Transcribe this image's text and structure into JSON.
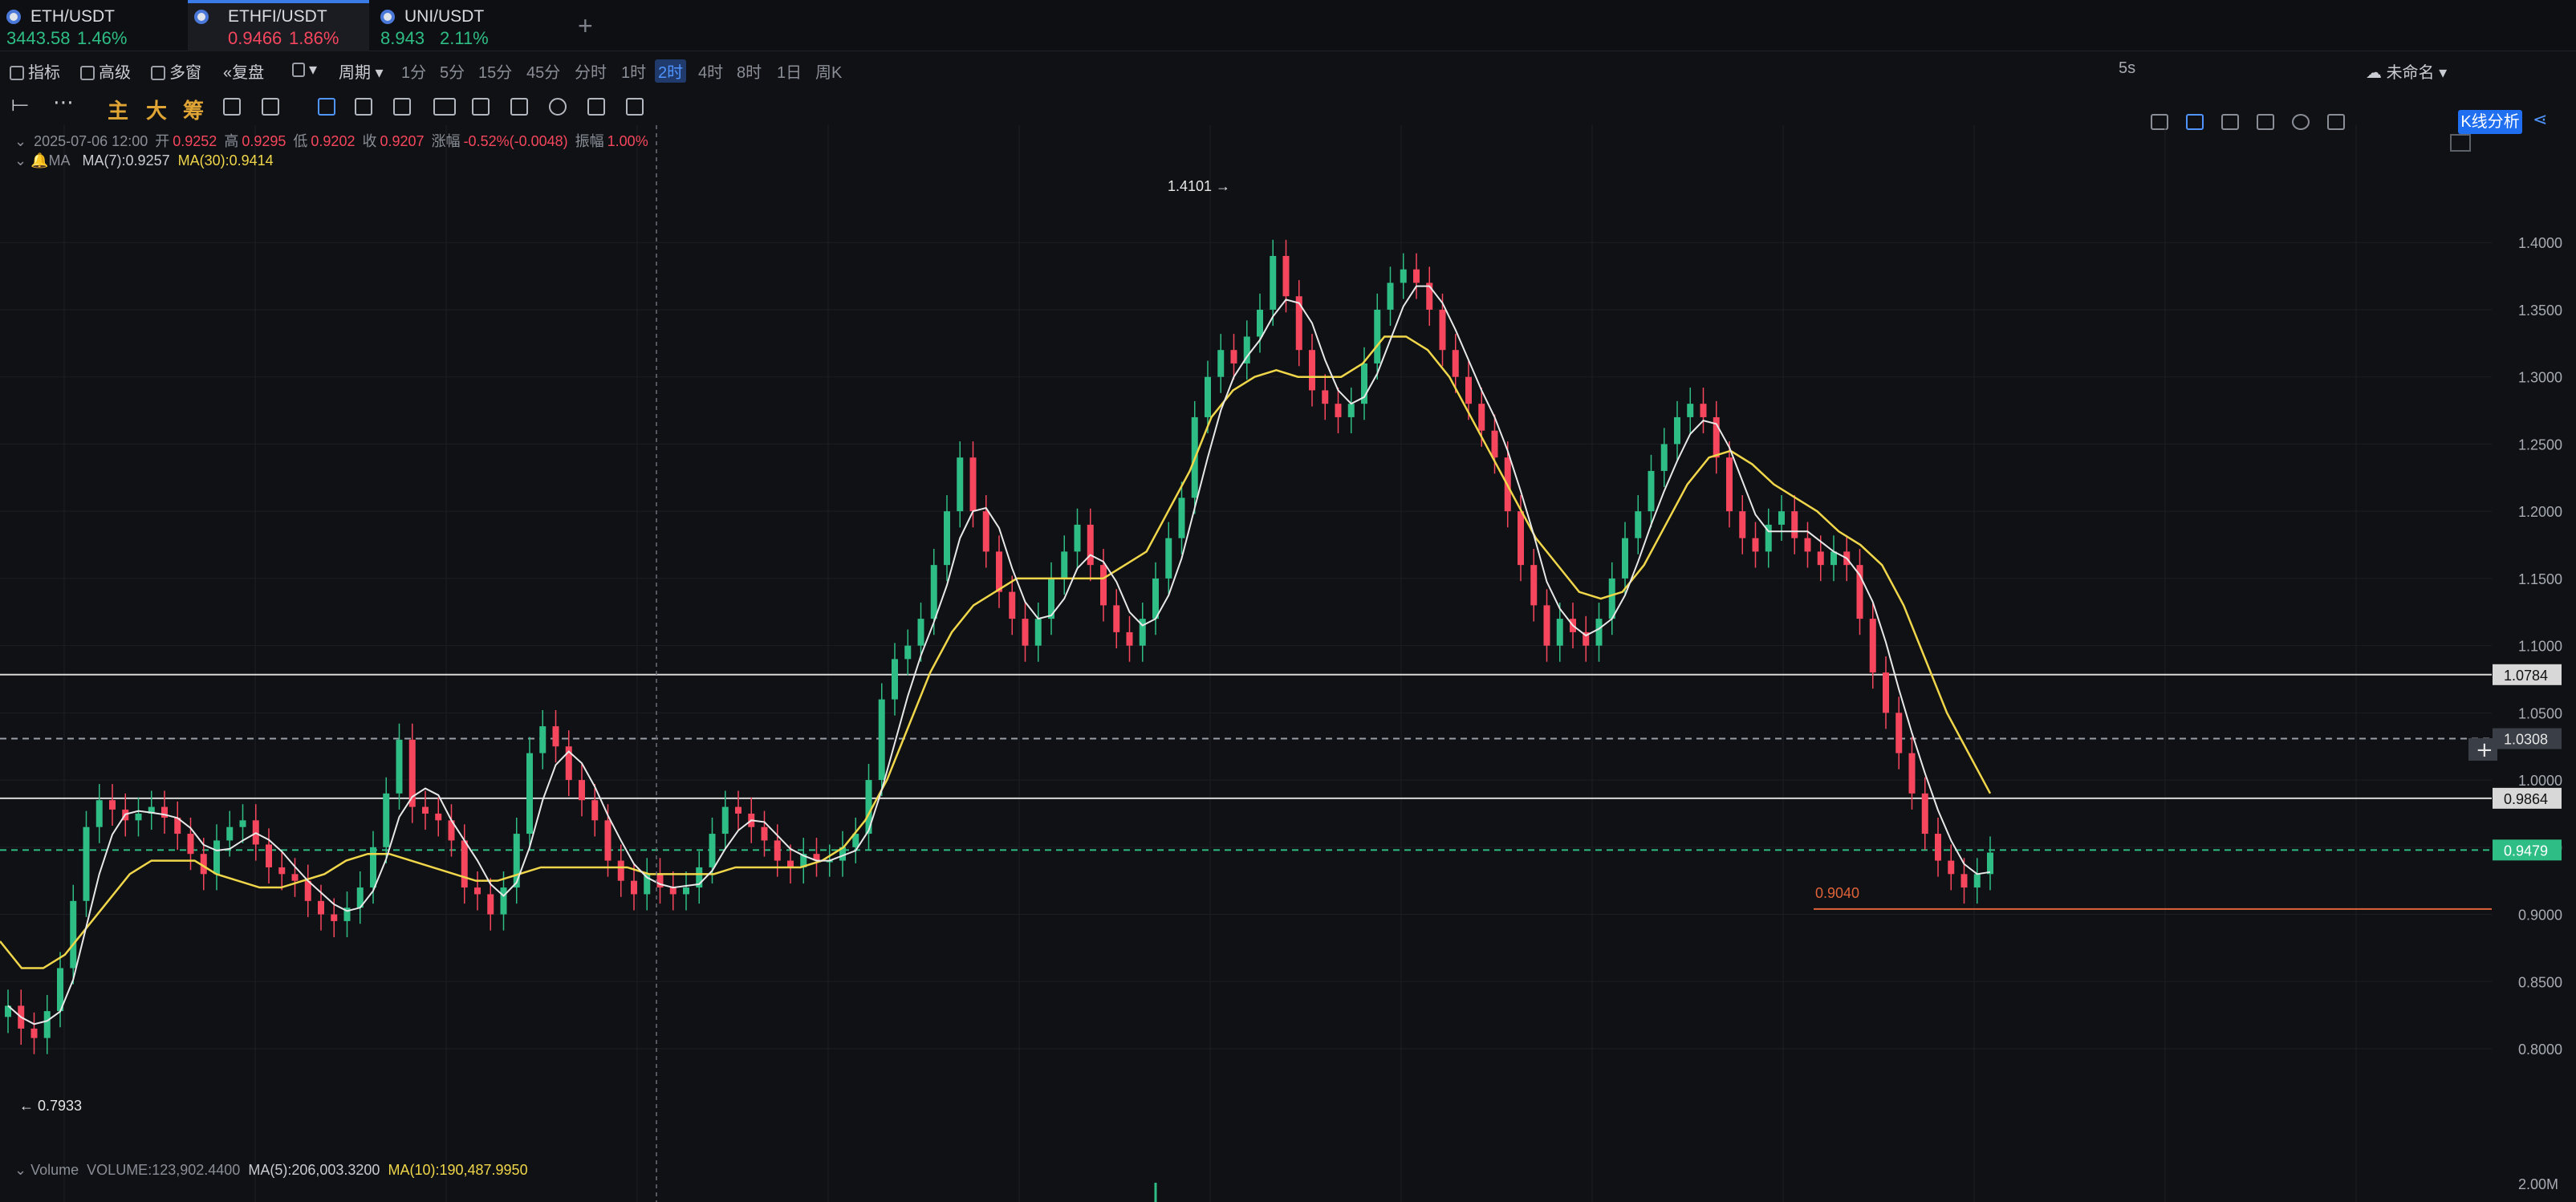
{
  "tabs": [
    {
      "pair": "ETH/USDT",
      "price": "3443.58",
      "change": "1.46%",
      "dir": "up"
    },
    {
      "pair": "ETHFI/USDT",
      "price": "0.9466",
      "change": "1.86%",
      "dir": "dn"
    },
    {
      "pair": "UNI/USDT",
      "price": "8.943",
      "change": "2.11%",
      "dir": "up"
    }
  ],
  "add_tab": "+",
  "toolbar": {
    "indicators": "指标",
    "advanced": "高级",
    "multi_window": "多窗",
    "replay": "复盘",
    "chart_type_icon": "candle-icon",
    "period": "周期",
    "periods": [
      "1分",
      "5分",
      "15分",
      "45分",
      "分时",
      "1时",
      "2时",
      "4时",
      "8时",
      "1日",
      "周K"
    ],
    "selected_period": "2时",
    "refresh": "5s",
    "layout_name": "未命名",
    "kline_analysis": "K线分析"
  },
  "drawing_tools": {
    "main": "主",
    "large": "大",
    "chips": "筹"
  },
  "ohlc": {
    "date": "2025-07-06 12:00",
    "open_label": "开",
    "open": "0.9252",
    "high_label": "高",
    "high": "0.9295",
    "low_label": "低",
    "low": "0.9202",
    "close_label": "收",
    "close": "0.9207",
    "change_label": "涨幅",
    "change": "-0.52%(-0.0048)",
    "amp_label": "振幅",
    "amp": "1.00%"
  },
  "ma": {
    "label": "MA",
    "ma7": "MA(7):0.9257",
    "ma30": "MA(30):0.9414"
  },
  "volume": {
    "label": "Volume",
    "value": "VOLUME:123,902.4400",
    "ma5": "MA(5):206,003.3200",
    "ma10": "MA(10):190,487.9950",
    "axis_label": "2.00M"
  },
  "colors": {
    "up": "#2ebd85",
    "down": "#f6465d",
    "ma7": "#e8e8e8",
    "ma30": "#f0d64a",
    "accent": "#1f6ff0"
  },
  "chart_data": {
    "type": "line",
    "y_axis": [
      "1.4000",
      "1.3500",
      "1.3000",
      "1.2500",
      "1.2000",
      "1.1500",
      "1.1000",
      "1.0500",
      "1.0000",
      "0.9500",
      "0.9000",
      "0.8500",
      "0.8000"
    ],
    "ylim": [
      0.76,
      1.43
    ],
    "close": [
      0.832,
      0.815,
      0.808,
      0.828,
      0.86,
      0.91,
      0.965,
      0.985,
      0.978,
      0.97,
      0.975,
      0.98,
      0.972,
      0.96,
      0.945,
      0.93,
      0.955,
      0.965,
      0.97,
      0.952,
      0.935,
      0.93,
      0.925,
      0.91,
      0.9,
      0.895,
      0.905,
      0.92,
      0.95,
      0.99,
      1.03,
      0.98,
      0.975,
      0.97,
      0.955,
      0.92,
      0.915,
      0.9,
      0.92,
      0.96,
      1.02,
      1.04,
      1.025,
      1.0,
      0.985,
      0.97,
      0.94,
      0.925,
      0.915,
      0.93,
      0.92,
      0.915,
      0.92,
      0.935,
      0.96,
      0.98,
      0.975,
      0.965,
      0.955,
      0.94,
      0.935,
      0.945,
      0.94,
      0.94,
      0.95,
      0.96,
      1.0,
      1.06,
      1.09,
      1.1,
      1.12,
      1.16,
      1.2,
      1.24,
      1.2,
      1.17,
      1.14,
      1.12,
      1.1,
      1.12,
      1.15,
      1.17,
      1.19,
      1.16,
      1.13,
      1.11,
      1.1,
      1.12,
      1.15,
      1.18,
      1.21,
      1.27,
      1.3,
      1.32,
      1.31,
      1.33,
      1.35,
      1.39,
      1.36,
      1.32,
      1.29,
      1.28,
      1.27,
      1.28,
      1.31,
      1.35,
      1.37,
      1.38,
      1.37,
      1.35,
      1.32,
      1.3,
      1.28,
      1.26,
      1.24,
      1.2,
      1.16,
      1.13,
      1.1,
      1.12,
      1.11,
      1.1,
      1.12,
      1.15,
      1.18,
      1.2,
      1.23,
      1.25,
      1.27,
      1.28,
      1.27,
      1.24,
      1.2,
      1.18,
      1.17,
      1.19,
      1.2,
      1.18,
      1.17,
      1.16,
      1.17,
      1.16,
      1.12,
      1.08,
      1.05,
      1.02,
      0.99,
      0.96,
      0.94,
      0.93,
      0.92,
      0.93,
      0.946
    ],
    "ma30": [
      0.88,
      0.86,
      0.86,
      0.87,
      0.89,
      0.91,
      0.93,
      0.94,
      0.94,
      0.94,
      0.93,
      0.925,
      0.92,
      0.92,
      0.925,
      0.93,
      0.94,
      0.945,
      0.945,
      0.94,
      0.935,
      0.93,
      0.925,
      0.925,
      0.93,
      0.935,
      0.935,
      0.935,
      0.935,
      0.935,
      0.93,
      0.93,
      0.93,
      0.93,
      0.935,
      0.935,
      0.935,
      0.935,
      0.94,
      0.95,
      0.97,
      1.0,
      1.04,
      1.08,
      1.11,
      1.13,
      1.14,
      1.15,
      1.15,
      1.15,
      1.15,
      1.15,
      1.16,
      1.17,
      1.2,
      1.23,
      1.27,
      1.29,
      1.3,
      1.305,
      1.3,
      1.3,
      1.3,
      1.31,
      1.33,
      1.33,
      1.32,
      1.3,
      1.27,
      1.24,
      1.21,
      1.18,
      1.16,
      1.14,
      1.135,
      1.14,
      1.16,
      1.19,
      1.22,
      1.24,
      1.245,
      1.235,
      1.22,
      1.21,
      1.2,
      1.185,
      1.175,
      1.16,
      1.13,
      1.09,
      1.05,
      1.02,
      0.99
    ]
  },
  "price_lines": [
    {
      "value": 1.0784,
      "label": "1.0784",
      "style": "solid",
      "color": "#d8d8d8"
    },
    {
      "value": 1.0308,
      "label": "1.0308",
      "style": "dashed",
      "color": "#9aa0a8"
    },
    {
      "value": 0.9864,
      "label": "0.9864",
      "style": "solid",
      "color": "#d8d8d8"
    },
    {
      "value": 0.9479,
      "label": "0.9479",
      "style": "dashed",
      "color": "#2ebd85"
    },
    {
      "value": 0.904,
      "label": "0.9040",
      "style": "solid",
      "color": "#e0633a"
    }
  ],
  "annotations": {
    "high": "1.4101 →",
    "low": "← 0.7933"
  }
}
